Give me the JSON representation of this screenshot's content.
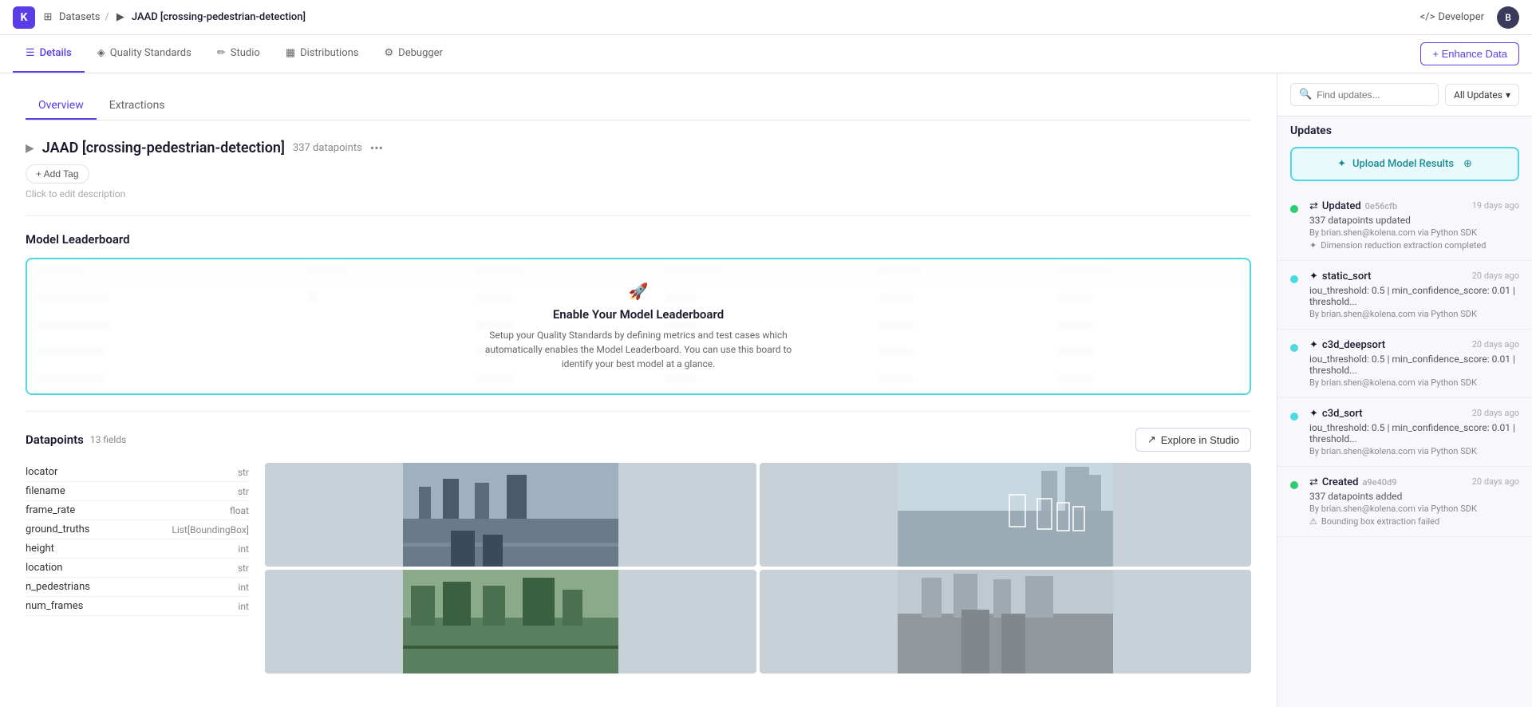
{
  "app": {
    "logo": "K",
    "breadcrumb": {
      "datasets_label": "Datasets",
      "separator": "/",
      "current": "JAAD [crossing-pedestrian-detection]"
    },
    "topnav": {
      "developer_label": "Developer",
      "avatar_initials": "B"
    }
  },
  "tabs": [
    {
      "id": "details",
      "label": "Details",
      "icon": "☰",
      "active": true
    },
    {
      "id": "quality-standards",
      "label": "Quality Standards",
      "icon": "◈",
      "active": false
    },
    {
      "id": "studio",
      "label": "Studio",
      "icon": "✏",
      "active": false
    },
    {
      "id": "distributions",
      "label": "Distributions",
      "icon": "▦",
      "active": false
    },
    {
      "id": "debugger",
      "label": "Debugger",
      "icon": "⚙",
      "active": false
    }
  ],
  "enhance_btn": "+ Enhance Data",
  "sub_tabs": [
    {
      "id": "overview",
      "label": "Overview",
      "active": true
    },
    {
      "id": "extractions",
      "label": "Extractions",
      "active": false
    }
  ],
  "dataset": {
    "name": "JAAD [crossing-pedestrian-detection]",
    "count": "337 datapoints",
    "add_tag_label": "+ Add Tag",
    "edit_desc": "Click to edit description"
  },
  "leaderboard": {
    "section_title": "Model Leaderboard",
    "overlay_icon": "🚀",
    "overlay_title": "Enable Your Model Leaderboard",
    "overlay_desc": "Setup your Quality Standards by defining metrics and test cases which automatically enables the Model Leaderboard. You can use this board to identify your best model at a glance.",
    "blurred_rows": [
      {
        "cols": [
          "",
          "",
          "",
          "",
          "",
          ""
        ]
      },
      {
        "cols": [
          "",
          "",
          "",
          "",
          "",
          ""
        ]
      },
      {
        "cols": [
          "",
          "",
          "",
          "",
          "",
          ""
        ]
      },
      {
        "cols": [
          "",
          "",
          "",
          "",
          "",
          ""
        ]
      }
    ]
  },
  "datapoints": {
    "section_title": "Datapoints",
    "fields_count": "13 fields",
    "explore_btn": "Explore in Studio ↗",
    "fields": [
      {
        "name": "locator",
        "type": "str"
      },
      {
        "name": "filename",
        "type": "str"
      },
      {
        "name": "frame_rate",
        "type": "float"
      },
      {
        "name": "ground_truths",
        "type": "List[BoundingBox]"
      },
      {
        "name": "height",
        "type": "int"
      },
      {
        "name": "location",
        "type": "str"
      },
      {
        "name": "n_pedestrians",
        "type": "int"
      },
      {
        "name": "num_frames",
        "type": "int"
      }
    ]
  },
  "right_panel": {
    "title": "Updates",
    "search_placeholder": "Find updates...",
    "filter_label": "All Updates",
    "upload_btn": "Upload Model Results",
    "timeline": [
      {
        "id": "updated",
        "dot_color": "green",
        "type": "arrow",
        "name": "Updated",
        "hash": "0e56cfb",
        "time_ago": "19 days ago",
        "desc": "337 datapoints updated",
        "by": "By brian.shen@kolena.com via Python SDK",
        "note": "Dimension reduction extraction completed",
        "note_icon": "spin"
      },
      {
        "id": "static_sort",
        "dot_color": "teal",
        "type": "asterisk",
        "name": "static_sort",
        "hash": "",
        "time_ago": "20 days ago",
        "desc": "iou_threshold: 0.5 | min_confidence_score: 0.01 | threshold...",
        "by": "By brian.shen@kolena.com via Python SDK",
        "note": "",
        "note_icon": ""
      },
      {
        "id": "c3d_deepsort",
        "dot_color": "teal",
        "type": "asterisk",
        "name": "c3d_deepsort",
        "hash": "",
        "time_ago": "20 days ago",
        "desc": "iou_threshold: 0.5 | min_confidence_score: 0.01 | threshold...",
        "by": "By brian.shen@kolena.com via Python SDK",
        "note": "",
        "note_icon": ""
      },
      {
        "id": "c3d_sort",
        "dot_color": "teal",
        "type": "asterisk",
        "name": "c3d_sort",
        "hash": "",
        "time_ago": "20 days ago",
        "desc": "iou_threshold: 0.5 | min_confidence_score: 0.01 | threshold...",
        "by": "By brian.shen@kolena.com via Python SDK",
        "note": "",
        "note_icon": ""
      },
      {
        "id": "created",
        "dot_color": "green",
        "type": "arrow",
        "name": "Created",
        "hash": "a9e40d9",
        "time_ago": "20 days ago",
        "desc": "337 datapoints added",
        "by": "By brian.shen@kolena.com via Python SDK",
        "note": "Bounding box extraction failed",
        "note_icon": "warn"
      }
    ]
  }
}
